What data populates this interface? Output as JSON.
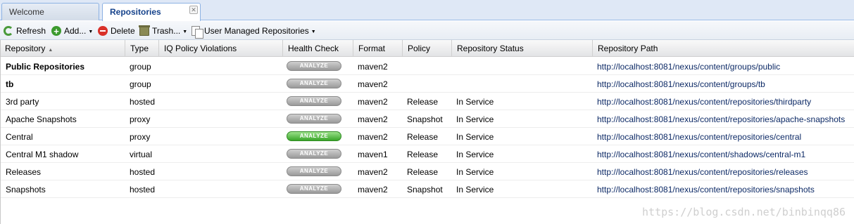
{
  "tabs": [
    {
      "label": "Welcome"
    },
    {
      "label": "Repositories",
      "close": "✕"
    }
  ],
  "toolbar": {
    "refresh": "Refresh",
    "add": "Add...",
    "delete": "Delete",
    "trash": "Trash...",
    "user_managed": "User Managed Repositories"
  },
  "columns": {
    "repository": "Repository",
    "type": "Type",
    "iq": "IQ Policy Violations",
    "health": "Health Check",
    "format": "Format",
    "policy": "Policy",
    "status": "Repository Status",
    "path": "Repository Path"
  },
  "rows": [
    {
      "name": "Public Repositories",
      "type": "group",
      "health": "ANALYZE",
      "format": "maven2",
      "policy": "",
      "status": "",
      "path": "http://localhost:8081/nexus/content/groups/public"
    },
    {
      "name": "tb",
      "type": "group",
      "health": "ANALYZE",
      "format": "maven2",
      "policy": "",
      "status": "",
      "path": "http://localhost:8081/nexus/content/groups/tb"
    },
    {
      "name": "3rd party",
      "type": "hosted",
      "health": "ANALYZE",
      "format": "maven2",
      "policy": "Release",
      "status": "In Service",
      "path": "http://localhost:8081/nexus/content/repositories/thirdparty"
    },
    {
      "name": "Apache Snapshots",
      "type": "proxy",
      "health": "ANALYZE",
      "format": "maven2",
      "policy": "Snapshot",
      "status": "In Service",
      "path": "http://localhost:8081/nexus/content/repositories/apache-snapshots"
    },
    {
      "name": "Central",
      "type": "proxy",
      "health": "ANALYZE",
      "format": "maven2",
      "policy": "Release",
      "status": "In Service",
      "path": "http://localhost:8081/nexus/content/repositories/central"
    },
    {
      "name": "Central M1 shadow",
      "type": "virtual",
      "health": "ANALYZE",
      "format": "maven1",
      "policy": "Release",
      "status": "In Service",
      "path": "http://localhost:8081/nexus/content/shadows/central-m1"
    },
    {
      "name": "Releases",
      "type": "hosted",
      "health": "ANALYZE",
      "format": "maven2",
      "policy": "Release",
      "status": "In Service",
      "path": "http://localhost:8081/nexus/content/repositories/releases"
    },
    {
      "name": "Snapshots",
      "type": "hosted",
      "health": "ANALYZE",
      "format": "maven2",
      "policy": "Snapshot",
      "status": "In Service",
      "path": "http://localhost:8081/nexus/content/repositories/snapshots"
    }
  ],
  "watermark": "https://blog.csdn.net/binbinqq86"
}
